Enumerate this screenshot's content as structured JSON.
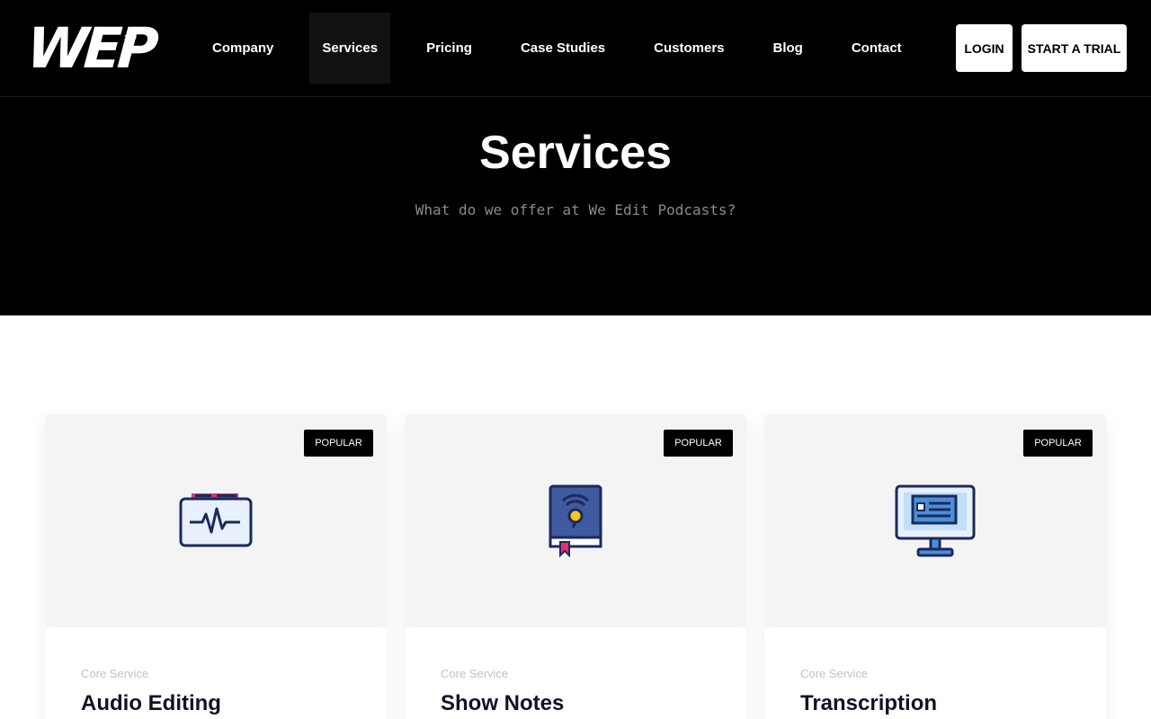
{
  "header": {
    "logo": {
      "text": "WEP",
      "version": "10.0"
    },
    "nav": [
      {
        "label": "Company"
      },
      {
        "label": "Services"
      },
      {
        "label": "Pricing"
      },
      {
        "label": "Case Studies"
      },
      {
        "label": "Customers"
      },
      {
        "label": "Blog"
      },
      {
        "label": "Contact"
      }
    ],
    "login_label": "LOGIN",
    "trial_label": "START A TRIAL"
  },
  "hero": {
    "title": "Services",
    "subtitle": "What do we offer at We Edit Podcasts?"
  },
  "cards": [
    {
      "badge": "POPULAR",
      "kicker": "Core Service",
      "title": "Audio Editing",
      "icon": "audio-waveform-icon"
    },
    {
      "badge": "POPULAR",
      "kicker": "Core Service",
      "title": "Show Notes",
      "icon": "podcast-book-icon"
    },
    {
      "badge": "POPULAR",
      "kicker": "Core Service",
      "title": "Transcription",
      "icon": "monitor-icon"
    }
  ],
  "colors": {
    "background_dark": "#000000",
    "card_media_bg": "#f4f4f5",
    "icon_navy": "#1b2a5c",
    "icon_blue": "#4a90d9",
    "icon_pink": "#e0336b"
  }
}
